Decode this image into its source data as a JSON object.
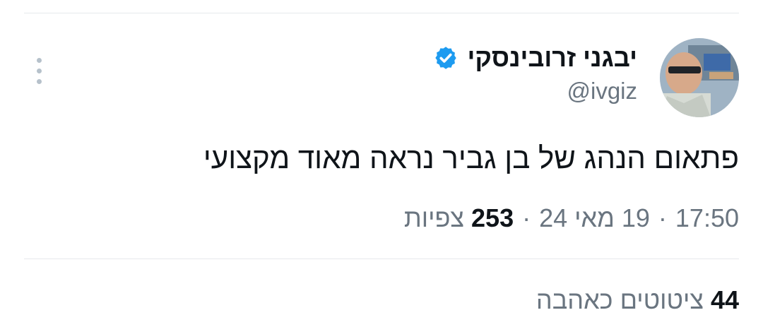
{
  "author": {
    "display_name": "יבגני זרובינסקי",
    "handle": "@ivgiz",
    "verified": true,
    "badge_color": "#1d9bf0"
  },
  "tweet": {
    "text": "פתאום הנהג של בן גביר נראה מאוד מקצועי"
  },
  "meta": {
    "time": "17:50",
    "date": "19 מאי 24",
    "views_count": "253",
    "views_label": "צפיות",
    "separator": "·"
  },
  "engagement": {
    "quotes_count": "44",
    "quotes_label": "ציטוטים כאהבה"
  },
  "icons": {
    "more": "more-vertical-icon",
    "verified": "verified-badge-icon"
  }
}
